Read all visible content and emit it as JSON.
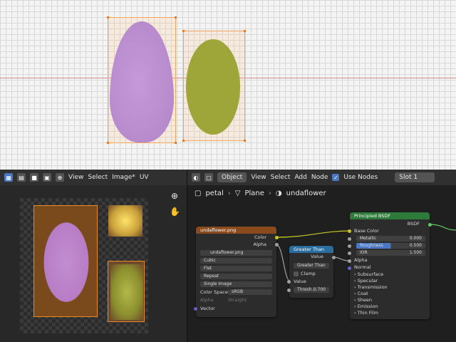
{
  "image_editor": {
    "menu": [
      "View",
      "Select",
      "Image*",
      "UV"
    ]
  },
  "node_editor": {
    "object_label": "Object",
    "menu": [
      "View",
      "Select",
      "Add",
      "Node"
    ],
    "use_nodes_label": "Use Nodes",
    "slot_label": "Slot 1",
    "breadcrumb": [
      "petal",
      "Plane",
      "undaflower"
    ]
  },
  "image_node": {
    "title": "undaflower.png",
    "out_color": "Color",
    "out_alpha": "Alpha",
    "image_name": "undaflower.png",
    "interpolation": "Cubic",
    "projection": "Flat",
    "extension": "Repeat",
    "source": "Single Image",
    "color_space_label": "Color Space",
    "color_space_value": "sRGB",
    "alpha_label": "Alpha",
    "alpha_value": "Straight",
    "in_vector": "Vector"
  },
  "math_node": {
    "title": "Greater Than",
    "out_value": "Value",
    "operation": "Greater Than",
    "clamp_label": "Clamp",
    "in_value": "Value",
    "thresh_label": "Thresh...",
    "thresh_value": "0.700"
  },
  "bsdf_node": {
    "title": "Principled BSDF",
    "out_bsdf": "BSDF",
    "base_color": "Base Color",
    "metallic_label": "Metallic",
    "metallic_value": "0.000",
    "roughness_label": "Roughness",
    "roughness_value": "0.500",
    "ior_label": "IOR",
    "ior_value": "1.500",
    "alpha_label": "Alpha",
    "normal_label": "Normal",
    "panels": [
      "Subsurface",
      "Specular",
      "Transmission",
      "Coat",
      "Sheen",
      "Emission",
      "Thin Film"
    ]
  },
  "colors": {
    "image_header": "#8a4a1c",
    "math_header": "#2a6ea0",
    "bsdf_header": "#2e7a3a",
    "selection": "#e88a2a",
    "accent": "#4a78c2"
  }
}
